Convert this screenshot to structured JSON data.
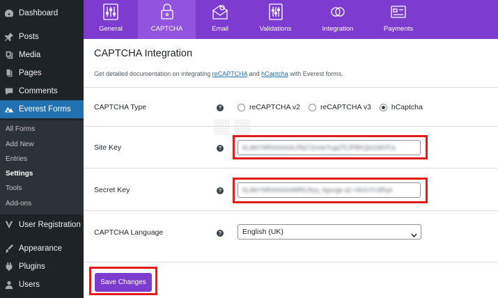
{
  "sidebar": {
    "items": [
      {
        "label": "Dashboard",
        "icon": "dashboard-icon"
      },
      {
        "label": "Posts",
        "icon": "pin-icon"
      },
      {
        "label": "Media",
        "icon": "media-icon"
      },
      {
        "label": "Pages",
        "icon": "pages-icon"
      },
      {
        "label": "Comments",
        "icon": "comment-icon"
      },
      {
        "label": "Everest Forms",
        "icon": "everest-forms-icon"
      },
      {
        "label": "User Registration",
        "icon": "user-registration-icon"
      },
      {
        "label": "Appearance",
        "icon": "brush-icon"
      },
      {
        "label": "Plugins",
        "icon": "plugin-icon"
      },
      {
        "label": "Users",
        "icon": "users-icon"
      }
    ],
    "submenu": [
      {
        "label": "All Forms"
      },
      {
        "label": "Add New"
      },
      {
        "label": "Entries"
      },
      {
        "label": "Settings"
      },
      {
        "label": "Tools"
      },
      {
        "label": "Add-ons"
      }
    ]
  },
  "tabs": [
    {
      "label": "General",
      "icon": "sliders-icon"
    },
    {
      "label": "CAPTCHA",
      "icon": "lock-icon"
    },
    {
      "label": "Email",
      "icon": "email-icon"
    },
    {
      "label": "Validations",
      "icon": "validations-icon"
    },
    {
      "label": "Integration",
      "icon": "integration-icon"
    },
    {
      "label": "Payments",
      "icon": "payments-icon"
    }
  ],
  "main": {
    "title": "CAPTCHA Integration",
    "desc_prefix": "Get detailed documentation on integrating ",
    "link_recaptcha": "reCAPTCHA",
    "desc_and": " and ",
    "link_hcaptcha": "hCaptcha",
    "desc_suffix": " with Everest forms.",
    "captcha_type_label": "CAPTCHA Type",
    "captcha_options": [
      "reCAPTCHA v2",
      "reCAPTCHA v3",
      "hCaptcha"
    ],
    "captcha_selected": "hCaptcha",
    "site_key_label": "Site Key",
    "site_key_value": "6LdfeYMRAAAAALRfyCSmdxTcgqTEJPBKQlzGMVFzj",
    "secret_key_label": "Secret Key",
    "secret_key_value": "6LdfeYMRAAAAAMRlLRyq_9gsngk-qC-HiUUYn3Rq4",
    "language_label": "CAPTCHA Language",
    "language_value": "English (UK)",
    "save_label": "Save Changes",
    "help_glyph": "?"
  },
  "colors": {
    "accent": "#7e3bd0",
    "highlight": "#e21a1a",
    "sidebar_bg": "#1d2327",
    "sidebar_active": "#2271b1"
  }
}
